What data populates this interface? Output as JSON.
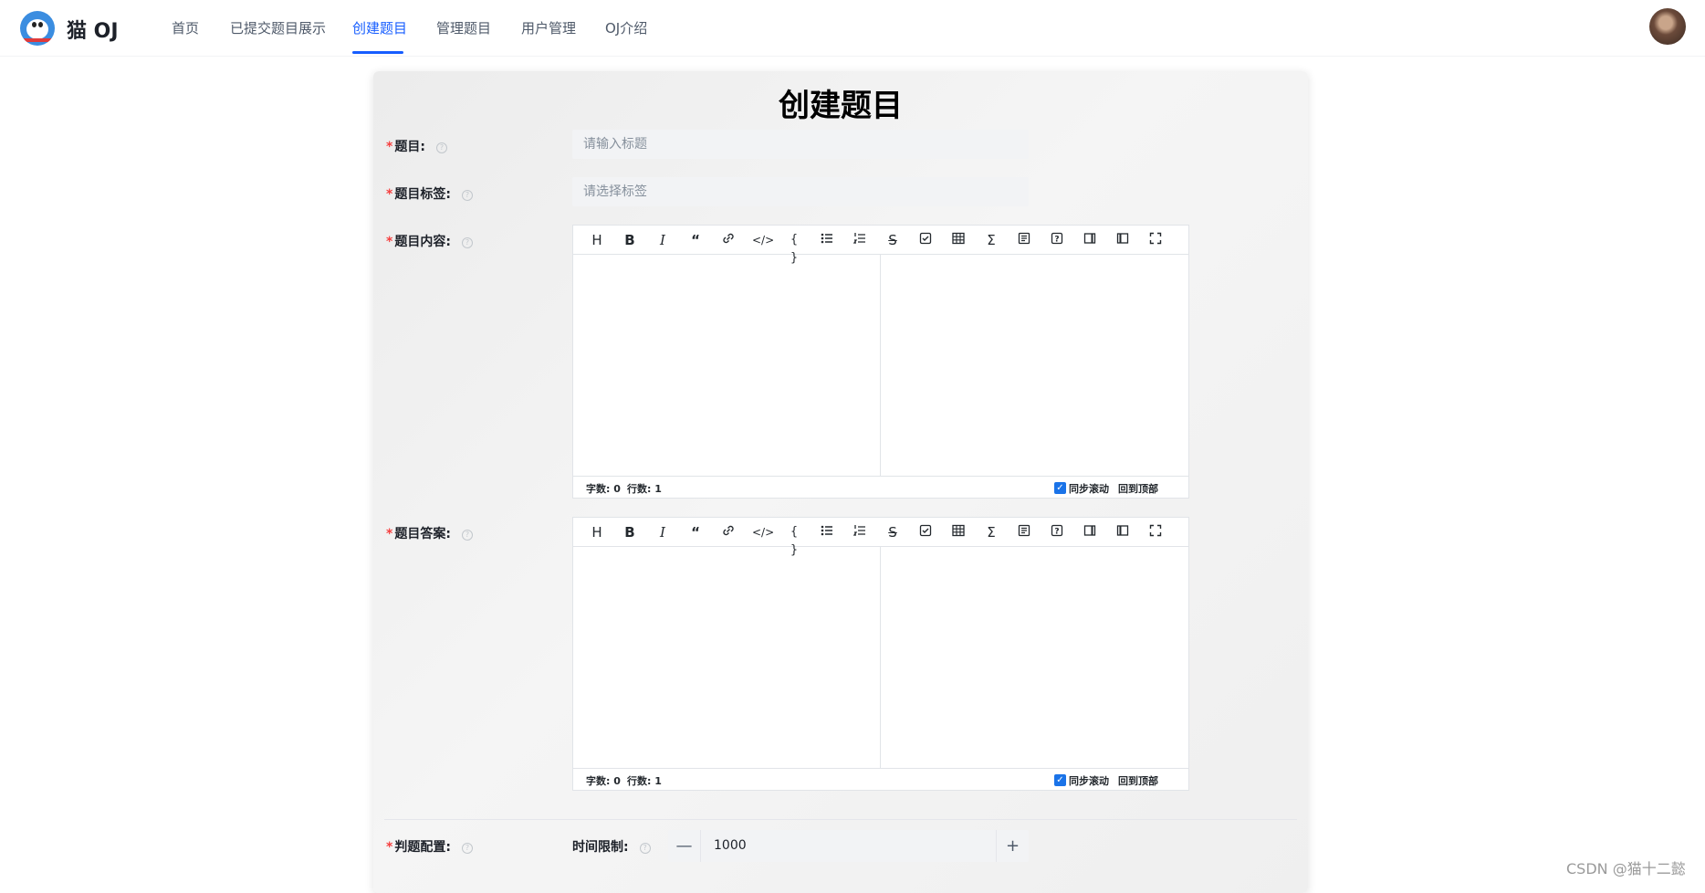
{
  "header": {
    "logo_text": "猫 OJ",
    "nav": [
      "首页",
      "已提交题目展示",
      "创建题目",
      "管理题目",
      "用户管理",
      "OJ介绍"
    ],
    "active_nav": "创建题目"
  },
  "page": {
    "title": "创建题目"
  },
  "form": {
    "required_mark": "*",
    "help_glyph": "?",
    "title_label": "题目:",
    "title_placeholder": "请输入标题",
    "tags_label": "题目标签:",
    "tags_placeholder": "请选择标签",
    "content_label": "题目内容:",
    "answer_label": "题目答案:",
    "judge_label": "判题配置:",
    "time_limit_label": "时间限制:",
    "time_limit_value": "1000",
    "minus": "—",
    "plus": "+"
  },
  "editor": {
    "toolbar": [
      "H",
      "B",
      "I",
      "“",
      "link",
      "code",
      "{ }",
      "ul",
      "ol",
      "strike",
      "task",
      "table",
      "Σ",
      "toc",
      "help",
      "preview-only",
      "editor-only",
      "fullscreen"
    ],
    "word_count": "字数: 0",
    "line_count": "行数: 1",
    "sync_scroll": "同步滚动",
    "back_to_top": "回到顶部"
  },
  "watermark": "CSDN @猫十二懿"
}
